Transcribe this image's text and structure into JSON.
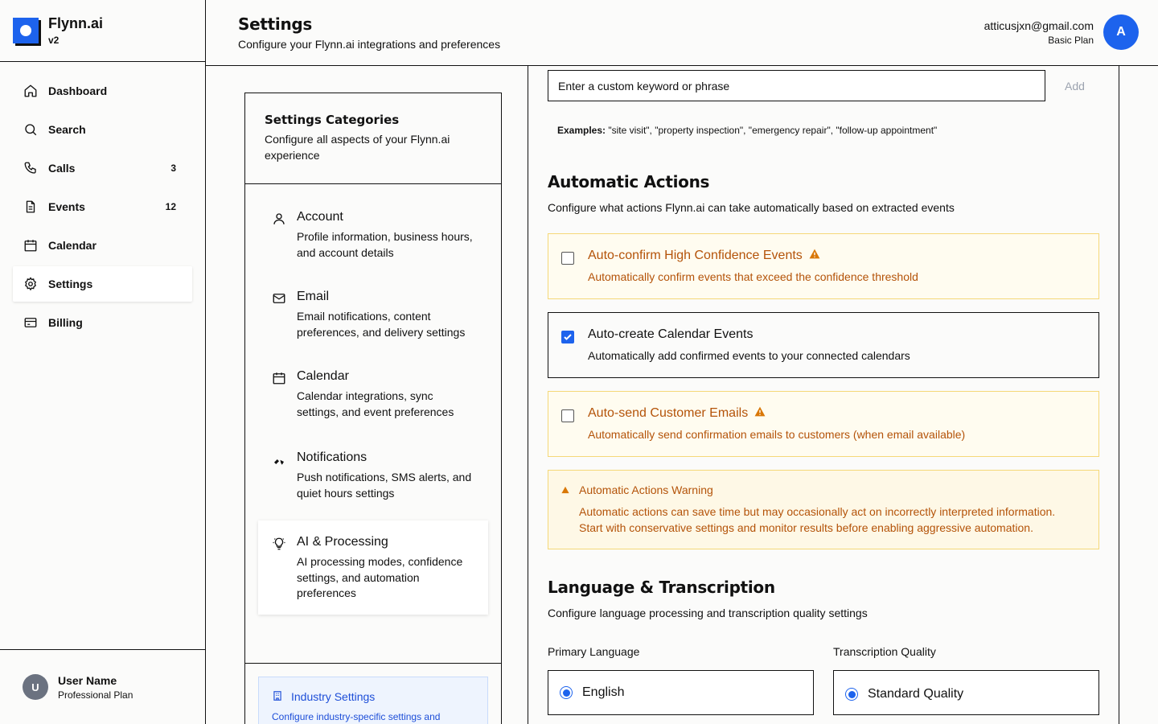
{
  "app": {
    "name": "Flynn.ai",
    "version": "v2"
  },
  "sidebar": {
    "items": [
      {
        "label": "Dashboard",
        "count": "",
        "icon": "home-icon"
      },
      {
        "label": "Search",
        "count": "",
        "icon": "search-icon"
      },
      {
        "label": "Calls",
        "count": "3",
        "icon": "phone-icon"
      },
      {
        "label": "Events",
        "count": "12",
        "icon": "document-icon"
      },
      {
        "label": "Calendar",
        "count": "",
        "icon": "calendar-icon"
      },
      {
        "label": "Settings",
        "count": "",
        "icon": "gear-icon",
        "active": true
      },
      {
        "label": "Billing",
        "count": "",
        "icon": "credit-card-icon"
      }
    ],
    "user": {
      "initial": "U",
      "name": "User Name",
      "plan": "Professional Plan"
    }
  },
  "header": {
    "title": "Settings",
    "subtitle": "Configure your Flynn.ai integrations and preferences",
    "email": "atticusjxn@gmail.com",
    "plan": "Basic Plan",
    "avatar_initial": "A"
  },
  "categories": {
    "title": "Settings Categories",
    "description": "Configure all aspects of your Flynn.ai experience",
    "items": [
      {
        "name": "Account",
        "description": "Profile information, business hours, and account details",
        "icon": "user-icon"
      },
      {
        "name": "Email",
        "description": "Email notifications, content preferences, and delivery settings",
        "icon": "mail-icon"
      },
      {
        "name": "Calendar",
        "description": "Calendar integrations, sync settings, and event preferences",
        "icon": "calendar-icon"
      },
      {
        "name": "Notifications",
        "description": "Push notifications, SMS alerts, and quiet hours settings",
        "icon": "bell-icon"
      },
      {
        "name": "AI & Processing",
        "description": "AI processing modes, confidence settings, and automation preferences",
        "icon": "lightbulb-icon",
        "active": true
      }
    ],
    "industry": {
      "title": "Industry Settings",
      "description": "Configure industry-specific settings and"
    }
  },
  "main": {
    "keyword": {
      "placeholder": "Enter a custom keyword or phrase",
      "add_label": "Add"
    },
    "examples_label": "Examples:",
    "examples_text": " \"site visit\", \"property inspection\", \"emergency repair\", \"follow-up appointment\"",
    "automatic_actions": {
      "title": "Automatic Actions",
      "description": "Configure what actions Flynn.ai can take automatically based on extracted events",
      "items": [
        {
          "name": "Auto-confirm High Confidence Events",
          "description": "Automatically confirm events that exceed the confidence threshold",
          "checked": false,
          "warning": true
        },
        {
          "name": "Auto-create Calendar Events",
          "description": "Automatically add confirmed events to your connected calendars",
          "checked": true,
          "warning": false
        },
        {
          "name": "Auto-send Customer Emails",
          "description": "Automatically send confirmation emails to customers (when email available)",
          "checked": false,
          "warning": true
        }
      ],
      "alert": {
        "title": "Automatic Actions Warning",
        "text": "Automatic actions can save time but may occasionally act on incorrectly interpreted information. Start with conservative settings and monitor results before enabling aggressive automation."
      }
    },
    "language": {
      "title": "Language & Transcription",
      "description": "Configure language processing and transcription quality settings",
      "primary_label": "Primary Language",
      "primary_value": "English",
      "quality_label": "Transcription Quality",
      "quality_value": "Standard Quality"
    }
  },
  "colors": {
    "accent": "#1d63ed",
    "warning": "#b45309",
    "warning_bg": "#fffcf0",
    "border": "#111111"
  }
}
